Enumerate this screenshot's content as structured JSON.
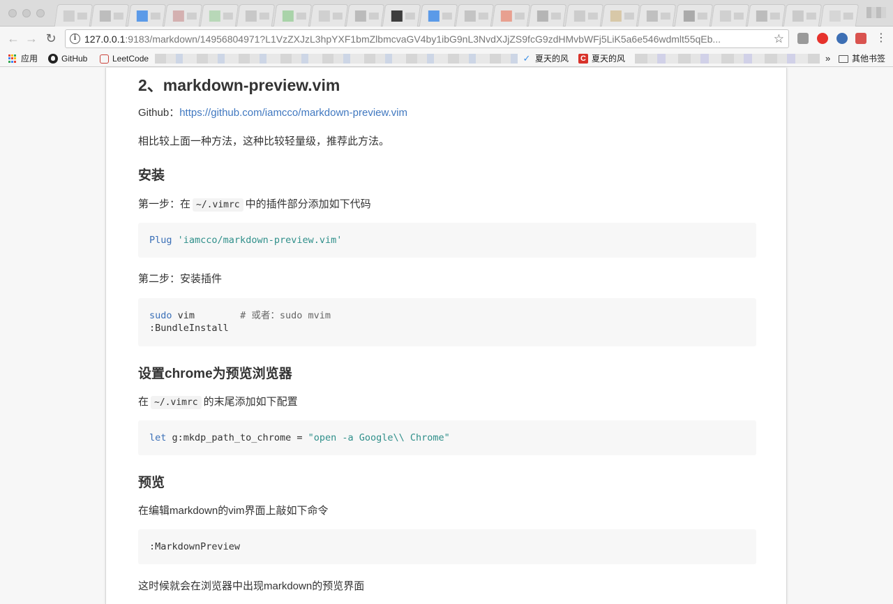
{
  "browser": {
    "url": {
      "host": "127.0.0.1",
      "rest": ":9183/markdown/14956804971?L1VzZXJzL3hpYXF1bmZlbmcvaGV4by1ibG9nL3NvdXJjZS9fcG9zdHMvbWFj5LiK5a6e546wdmlt55qEb..."
    },
    "bookmarks": [
      {
        "label": "应用",
        "icon": "apps-grid-icon"
      },
      {
        "label": "GitHub",
        "icon": "github-icon"
      },
      {
        "label": "LeetCode",
        "icon": "leetcode-icon"
      },
      {
        "label": "夏天的风",
        "icon": "bird-icon"
      },
      {
        "label": "夏天的风",
        "icon": "csdn-icon"
      },
      {
        "label": "其他书签",
        "icon": "folder-icon"
      }
    ],
    "overflow": "»"
  },
  "doc": {
    "heading": "2、markdown-preview.vim",
    "github_label": "Github：",
    "github_link": "https://github.com/iamcco/markdown-preview.vim",
    "intro": "相比较上面一种方法，这种比较轻量级，推荐此方法。",
    "install_heading": "安装",
    "step1_prefix": "第一步：在",
    "step1_code": "~/.vimrc",
    "step1_suffix": "中的插件部分添加如下代码",
    "code1": {
      "kw": "Plug",
      "str": "'iamcco/markdown-preview.vim'"
    },
    "step2": "第二步：安装插件",
    "code2": {
      "kw": "sudo",
      "rest": " vim",
      "comment": "# 或者：sudo mvim",
      "line2": ":BundleInstall"
    },
    "chrome_heading": "设置chrome为预览浏览器",
    "chrome_prefix": "在",
    "chrome_code": "~/.vimrc",
    "chrome_suffix": "的末尾添加如下配置",
    "code3": {
      "kw": "let",
      "rest": " g:mkdp_path_to_chrome = ",
      "str": "\"open -a Google\\\\ Chrome\""
    },
    "preview_heading": "预览",
    "preview_text": "在编辑markdown的vim界面上敲如下命令",
    "code4": ":MarkdownPreview",
    "final_text": "这时候就会在浏览器中出现markdown的预览界面"
  }
}
